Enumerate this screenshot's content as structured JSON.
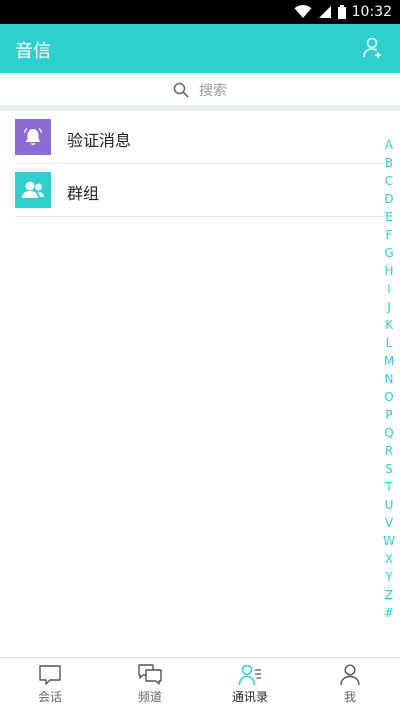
{
  "status_bar": {
    "time": "10:32"
  },
  "app_bar": {
    "title": "音信",
    "action_icon": "add-contact-icon"
  },
  "search": {
    "placeholder": "搜索"
  },
  "list": [
    {
      "label": "验证消息",
      "icon": "bell-icon",
      "color": "#8e6bd2"
    },
    {
      "label": "群组",
      "icon": "group-icon",
      "color": "#2ecfcf"
    }
  ],
  "index_letters": [
    "A",
    "B",
    "C",
    "D",
    "E",
    "F",
    "G",
    "H",
    "I",
    "J",
    "K",
    "L",
    "M",
    "N",
    "O",
    "P",
    "Q",
    "R",
    "S",
    "T",
    "U",
    "V",
    "W",
    "X",
    "Y",
    "Z",
    "#"
  ],
  "tabs": [
    {
      "label": "会话",
      "icon": "chat-icon",
      "active": false
    },
    {
      "label": "频道",
      "icon": "channel-icon",
      "active": false
    },
    {
      "label": "通讯录",
      "icon": "contacts-icon",
      "active": true
    },
    {
      "label": "我",
      "icon": "profile-icon",
      "active": false
    }
  ],
  "colors": {
    "accent": "#2ecfcf",
    "purple": "#8e6bd2",
    "status_bar": "#000000"
  }
}
